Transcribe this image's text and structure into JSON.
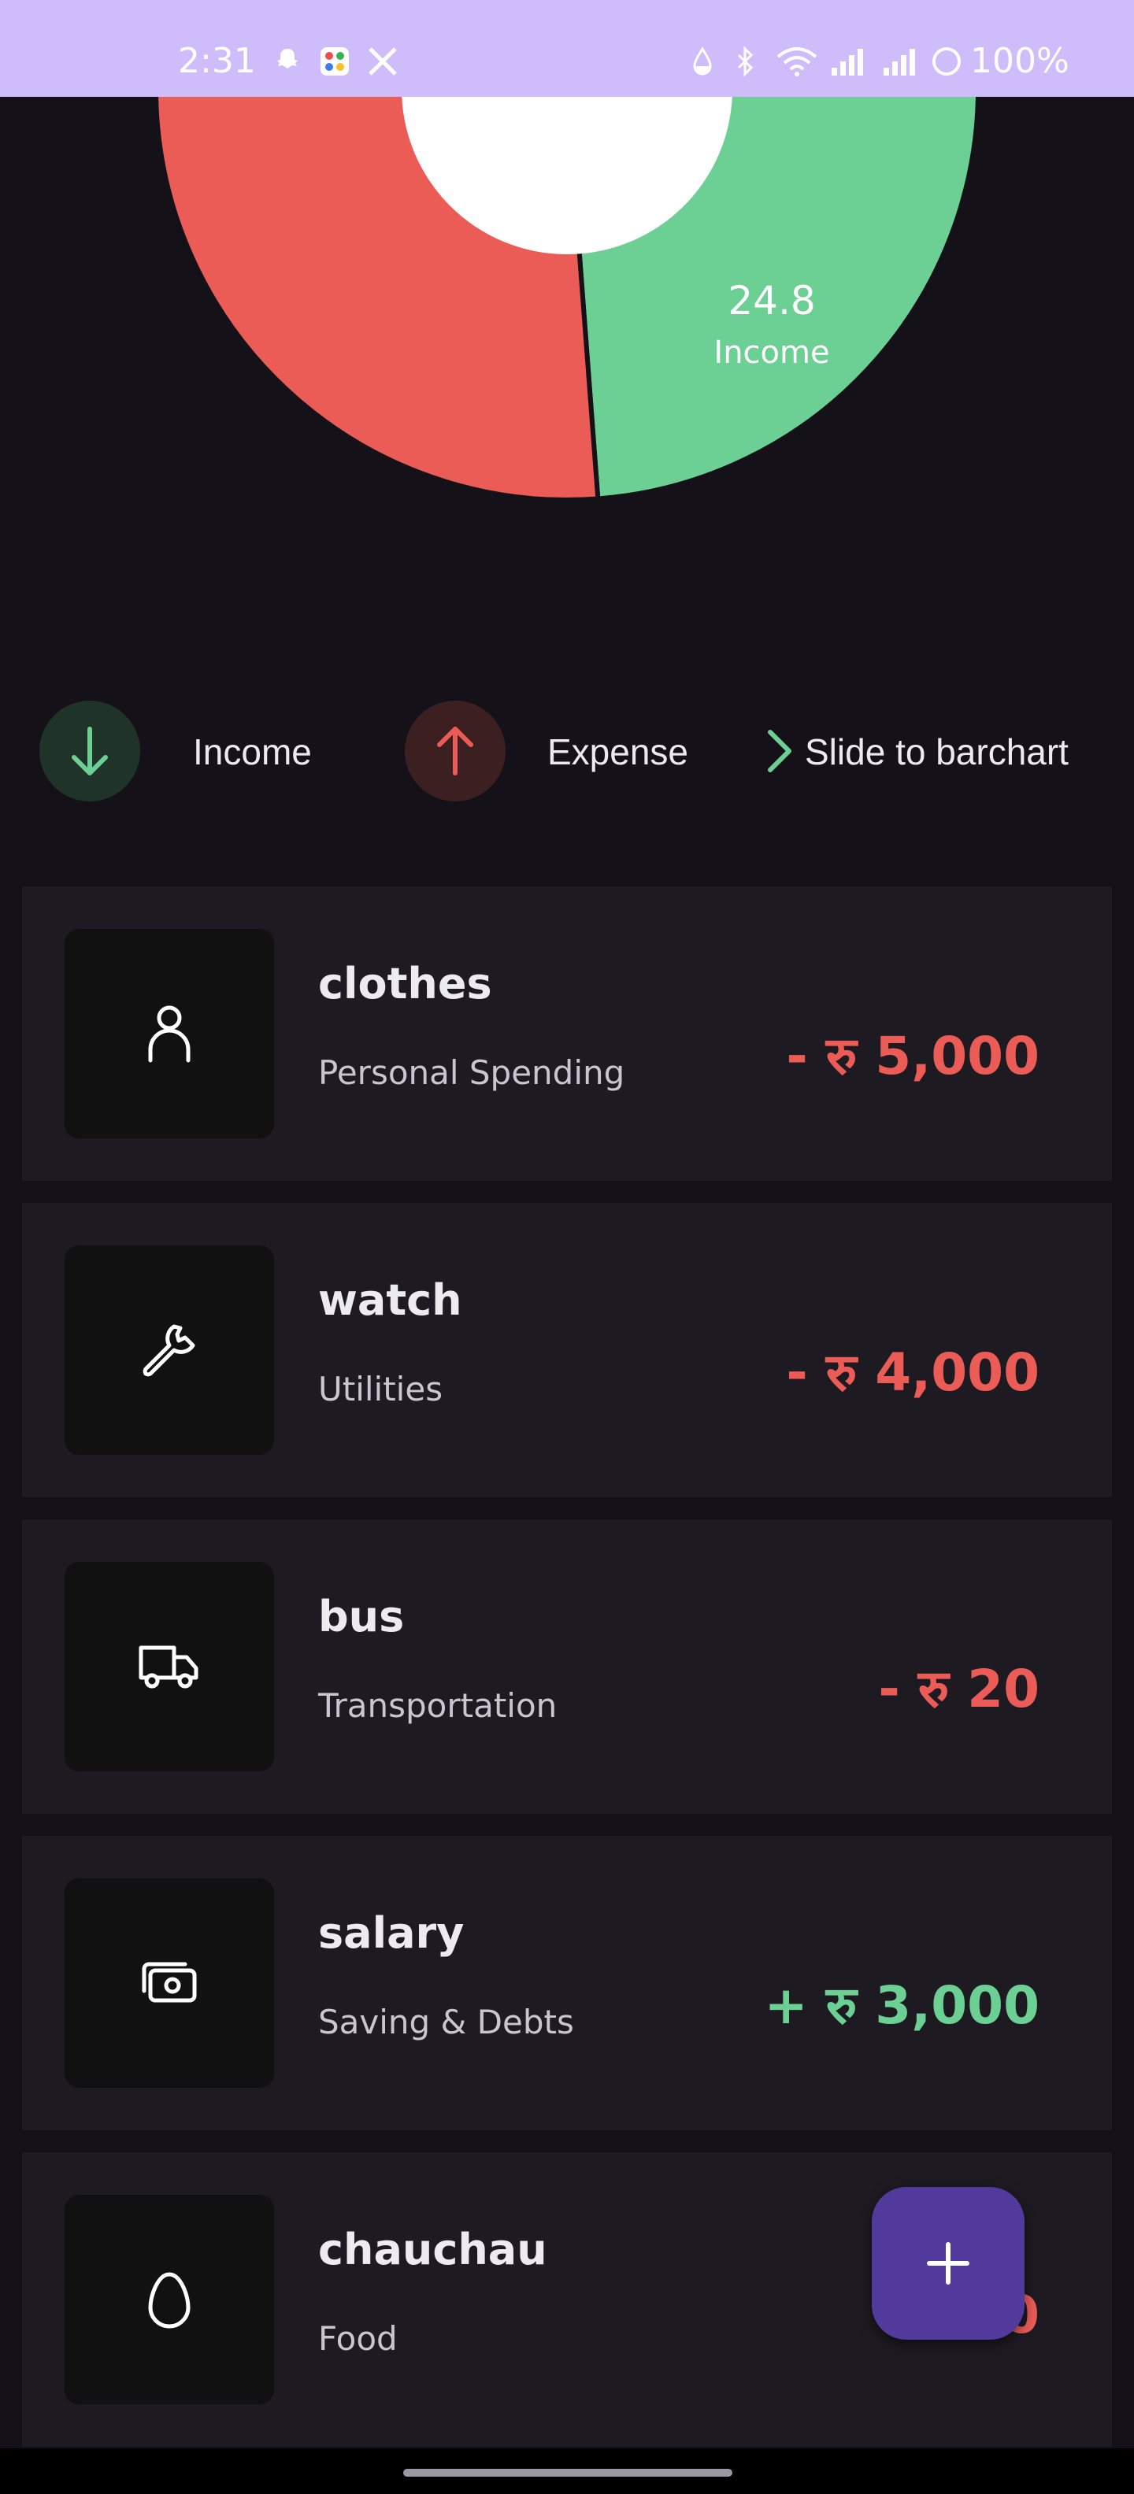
{
  "status_bar": {
    "time": "2:31",
    "battery_text": "100%",
    "icons": [
      "snapchat-icon",
      "photos-icon",
      "x-icon",
      "drop-icon",
      "bluetooth-icon",
      "wifi-icon",
      "signal-icon",
      "signal-icon",
      "battery-icon"
    ]
  },
  "chart_data": {
    "type": "pie",
    "slices": [
      {
        "label": "Income",
        "value": 24.8,
        "color": "#6ccf94"
      },
      {
        "label": "Expense",
        "value": 75.2,
        "color": "#eb5c57"
      }
    ],
    "center_hole_color": "#ffffff",
    "label_shown": {
      "value": "24.8",
      "label": "Income"
    }
  },
  "legend": {
    "income_label": "Income",
    "expense_label": "Expense",
    "slide_label": "Slide to barchart",
    "income_color": "#6ccf94",
    "expense_color": "#eb5c57"
  },
  "transactions": [
    {
      "title": "clothes",
      "category": "Personal Spending",
      "amount": "- रु 5,000",
      "type": "expense",
      "icon": "person-icon"
    },
    {
      "title": "watch",
      "category": "Utilities",
      "amount": "- रु 4,000",
      "type": "expense",
      "icon": "wrench-icon"
    },
    {
      "title": "bus",
      "category": "Transportation",
      "amount": "- रु 20",
      "type": "expense",
      "icon": "truck-icon"
    },
    {
      "title": "salary",
      "category": "Saving & Debts",
      "amount": "+ रु 3,000",
      "type": "income",
      "icon": "money-icon"
    },
    {
      "title": "chauchau",
      "category": "Food",
      "amount": "0",
      "type": "expense",
      "icon": "egg-icon"
    }
  ],
  "fab": {
    "icon": "plus-icon",
    "color": "#523a9c"
  }
}
